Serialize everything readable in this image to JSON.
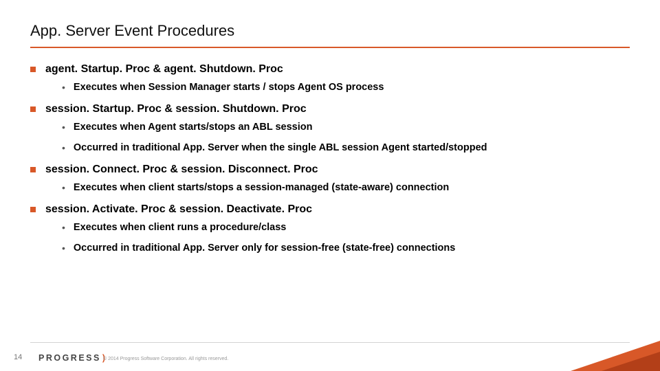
{
  "title": "App. Server Event Procedures",
  "sections": [
    {
      "heading": "agent. Startup. Proc & agent. Shutdown. Proc",
      "subs": [
        "Executes when Session Manager starts / stops Agent OS process"
      ]
    },
    {
      "heading": "session. Startup. Proc & session. Shutdown. Proc",
      "subs": [
        "Executes when Agent starts/stops an ABL session",
        "Occurred in traditional App. Server when the single ABL session Agent started/stopped"
      ]
    },
    {
      "heading": "session. Connect. Proc & session. Disconnect. Proc",
      "subs": [
        "Executes when client starts/stops a session-managed (state-aware) connection"
      ]
    },
    {
      "heading": "session. Activate. Proc & session. Deactivate. Proc",
      "subs": [
        "Executes when client runs a procedure/class",
        "Occurred in traditional App. Server only for session-free (state-free) connections"
      ]
    }
  ],
  "footer": {
    "page": "14",
    "brand": "PROGRESS",
    "copyright": "© 2014 Progress Software Corporation. All rights reserved."
  }
}
